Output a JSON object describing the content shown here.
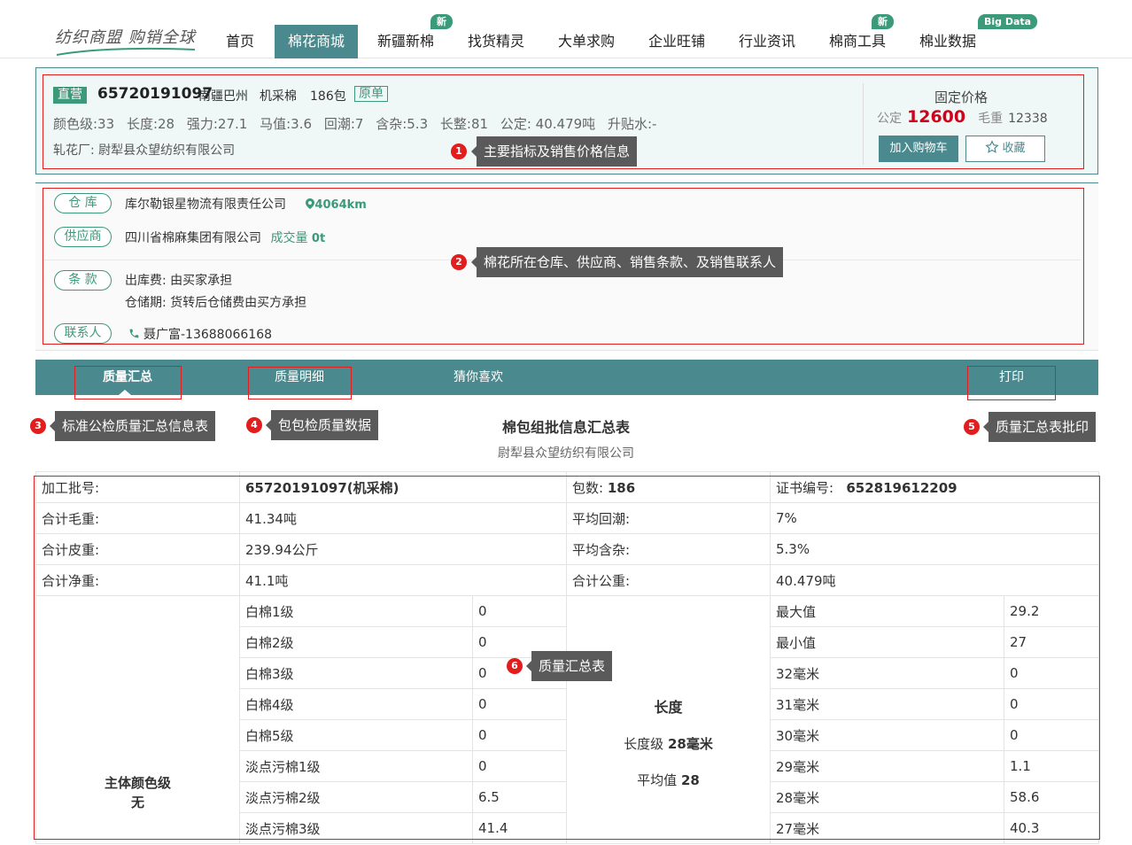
{
  "brand": {
    "logo_text": "纺织商盟  购销全球"
  },
  "nav": {
    "items": [
      {
        "label": "首页"
      },
      {
        "label": "棉花商城"
      },
      {
        "label": "新疆新棉",
        "badge": "新"
      },
      {
        "label": "找货精灵"
      },
      {
        "label": "大单求购"
      },
      {
        "label": "企业旺铺"
      },
      {
        "label": "行业资讯"
      },
      {
        "label": "棉商工具",
        "badge": "新"
      },
      {
        "label": "棉业数据",
        "badge": "Big Data"
      }
    ]
  },
  "product": {
    "direct_tag": "直营",
    "batch_no": "65720191097",
    "region": "南疆巴州",
    "pick_type": "机采棉",
    "bales": "186包",
    "orig_tag": "原单",
    "indices": [
      "颜色级:33",
      "长度:28",
      "强力:27.1",
      "马值:3.6",
      "回潮:7",
      "含杂:5.3",
      "长整:81",
      "公定: 40.479吨",
      "升贴水:-"
    ],
    "ginnery": "轧花厂: 尉犁县众望纺织有限公司",
    "price_title": "固定价格",
    "price_label": "公定",
    "price_value": "12600",
    "gross_label": "毛重",
    "gross_value": "12338",
    "cart_button": "加入购物车",
    "fav_button": "收藏"
  },
  "details": {
    "warehouse_label": "仓 库",
    "warehouse_name": "库尔勒银星物流有限责任公司",
    "warehouse_distance": "4064km",
    "supplier_label": "供应商",
    "supplier_name": "四川省棉麻集团有限公司",
    "supplier_volume_label": "成交量",
    "supplier_volume": "0t",
    "terms_label": "条 款",
    "terms_line1": "出库费: 由买家承担",
    "terms_line2": "仓储期: 货转后仓储费由买方承担",
    "contact_label": "联系人",
    "contact_value": "聂广富-13688066168"
  },
  "tabs": [
    {
      "label": "质量汇总"
    },
    {
      "label": "质量明细"
    },
    {
      "label": "猜你喜欢"
    },
    {
      "label": "打印"
    }
  ],
  "summary": {
    "title": "棉包组批信息汇总表",
    "subtitle": "尉犁县众望纺织有限公司",
    "batch_label": "加工批号:",
    "batch_value": "65720191097(机采棉)",
    "bales_label": "包数:",
    "bales_value": "186",
    "cert_label": "证书编号:",
    "cert_value": "652819612209",
    "rows": [
      {
        "l1": "合计毛重:",
        "v1": "41.34吨",
        "l2": "平均回潮:",
        "v2": "7%"
      },
      {
        "l1": "合计皮重:",
        "v1": "239.94公斤",
        "l2": "平均含杂:",
        "v2": "5.3%"
      },
      {
        "l1": "合计净重:",
        "v1": "41.1吨",
        "l2": "合计公重:",
        "v2": "40.479吨"
      }
    ],
    "color_main_line1": "主体颜色级",
    "color_main_line2": "无",
    "color_grades": [
      {
        "name": "白棉1级",
        "value": "0"
      },
      {
        "name": "白棉2级",
        "value": "0"
      },
      {
        "name": "白棉3级",
        "value": "0"
      },
      {
        "name": "白棉4级",
        "value": "0"
      },
      {
        "name": "白棉5级",
        "value": "0"
      },
      {
        "name": "淡点污棉1级",
        "value": "0"
      },
      {
        "name": "淡点污棉2级",
        "value": "6.5"
      },
      {
        "name": "淡点污棉3级",
        "value": "41.4"
      }
    ],
    "length_title": "长度",
    "length_grade_label": "长度级",
    "length_grade_value": "28毫米",
    "length_avg_label": "平均值",
    "length_avg_value": "28",
    "length_rows": [
      {
        "name": "最大值",
        "value": "29.2"
      },
      {
        "name": "最小值",
        "value": "27"
      },
      {
        "name": "32毫米",
        "value": "0"
      },
      {
        "name": "31毫米",
        "value": "0"
      },
      {
        "name": "30毫米",
        "value": "0"
      },
      {
        "name": "29毫米",
        "value": "1.1"
      },
      {
        "name": "28毫米",
        "value": "58.6"
      },
      {
        "name": "27毫米",
        "value": "40.3"
      }
    ]
  },
  "annotations": [
    {
      "num": "1",
      "text": "主要指标及销售价格信息"
    },
    {
      "num": "2",
      "text": "棉花所在仓库、供应商、销售条款、及销售联系人"
    },
    {
      "num": "3",
      "text": "标准公检质量汇总信息表"
    },
    {
      "num": "4",
      "text": "包包检质量数据"
    },
    {
      "num": "5",
      "text": "质量汇总表批印"
    },
    {
      "num": "6",
      "text": "质量汇总表"
    }
  ],
  "colors": {
    "accent": "#4a8a8e",
    "green": "#3a9a7a",
    "price": "#d0021b",
    "annotation": "#e11d1d"
  }
}
